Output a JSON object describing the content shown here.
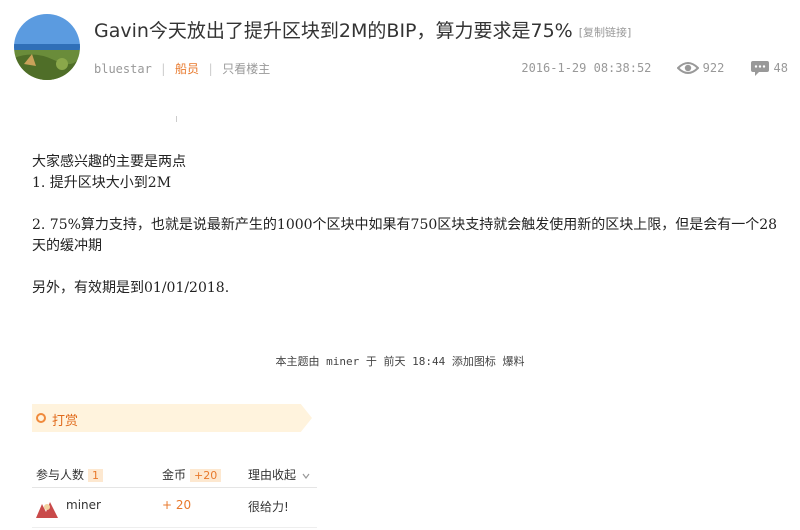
{
  "post": {
    "title": "Gavin今天放出了提升区块到2M的BIP，算力要求是75%",
    "copy_link": "[复制链接]",
    "author": "bluestar",
    "role": "船员",
    "only_op": "只看楼主",
    "timestamp": "2016-1-29 08:38:52",
    "views": "922",
    "replies": "48",
    "body": {
      "line1": "大家感兴趣的主要是两点",
      "line2": "1. 提升区块大小到2M",
      "line3": "2. 75%算力支持，也就是说最新产生的1000个区块中如果有750区块支持就会触发使用新的区块上限，但是会有一个28天的缓冲期",
      "line4": "另外，有效期是到01/01/2018."
    },
    "edit_note": "本主题由 miner 于 前天 18:44 添加图标 爆料"
  },
  "reward": {
    "label": "打赏",
    "header": {
      "participants_label": "参与人数",
      "participants_count": "1",
      "coins_label": "金币",
      "coins_value": "+20",
      "reason_label": "理由收起"
    },
    "rows": [
      {
        "user": "miner",
        "coins": "+ 20",
        "reason": "很给力!"
      }
    ]
  },
  "colors": {
    "accent": "#e8792c",
    "reward_bg": "#fff3dd"
  },
  "icons": {
    "views": "eye-icon",
    "replies": "comment-icon",
    "reward": "ring-icon",
    "collapse": "chevron-down-icon"
  }
}
